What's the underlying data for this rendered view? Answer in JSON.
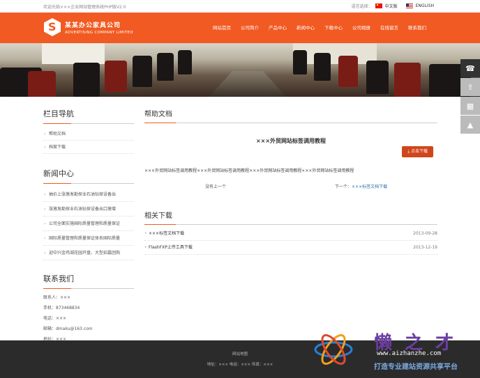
{
  "topbar": {
    "welcome": "欢迎光临×××企业网站管理系统PHP版V2.0",
    "lang_label": "语言选择：",
    "lang_cn": "中文版",
    "lang_en": "ENGLISH"
  },
  "header": {
    "company_cn": "某某办公家具公司",
    "company_en": "ADVERTISING COMPANY LIMITED",
    "nav": [
      "网站首页",
      "公司简介",
      "产品中心",
      "新闻中心",
      "下载中心",
      "公司相册",
      "在线留言",
      "联系我们"
    ]
  },
  "sidebar": {
    "column_title": "栏目导航",
    "column_items": [
      "帮助文档",
      "档案下载"
    ],
    "news_title": "新闻中心",
    "news_items": [
      "抽价上涨激发勘探业石油钻探设备出",
      "涨激发勘探业石油钻探设备出口激增",
      "公司全面实施国际质量管理和质量保证",
      "国际质量管理和质量保证体系国际质量",
      "迎中兴金鸡湖花园开盘、大型招募团购"
    ],
    "contact_title": "联系我们",
    "contact": [
      "联系人：×××",
      "手机：873468834",
      "电话：×××",
      "邮箱：dmaku@163.com",
      "地址：×××"
    ]
  },
  "main": {
    "section_title": "帮助文档",
    "doc_title": "×××外贸网站标签调用教程",
    "download_button": "点击下载",
    "doc_body": "×××外贸网站标签调用教程×××外贸网站标签调用教程×××外贸网站标签调用教程×××外贸网站标签调用教程",
    "prev": "没有上一个",
    "next_label": "下一个：",
    "next_link": "×××标签文档下载",
    "related_title": "相关下载",
    "related": [
      {
        "title": "×××标签文档下载",
        "date": "2013-09-28"
      },
      {
        "title": "FlashFXP上传工具下载",
        "date": "2013-12-19"
      }
    ]
  },
  "footer": {
    "sitemap": "网站地图",
    "info": "地址：××× 电话：××× 传真：×××"
  },
  "watermark": {
    "brand": "懒之才",
    "url": "www.aizhanzhe.com",
    "slogan": "打造专业建站资源共享平台"
  },
  "colors": {
    "accent": "#f15a22",
    "footer": "#2b2b2b",
    "button": "#d0461c"
  }
}
